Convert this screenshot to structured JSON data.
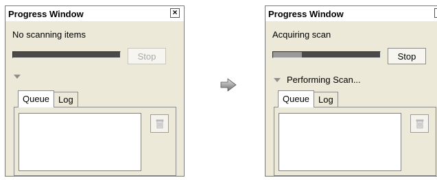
{
  "left_window": {
    "title": "Progress Window",
    "status": "No scanning items",
    "progress_fraction": 0,
    "stop_label": "Stop",
    "stop_enabled": false,
    "disclosure_label": "",
    "tabs": [
      "Queue",
      "Log"
    ],
    "active_tab": "Queue"
  },
  "right_window": {
    "title": "Progress Window",
    "status": "Acquiring scan",
    "progress_fraction": 0.27,
    "stop_label": "Stop",
    "stop_enabled": true,
    "disclosure_label": "Performing Scan...",
    "tabs": [
      "Queue",
      "Log"
    ],
    "active_tab": "Queue"
  },
  "icons": {
    "close": "close-icon",
    "trash": "trash-icon",
    "arrow": "arrow-right-icon",
    "disclosure": "disclosure-triangle-icon"
  },
  "colors": {
    "window_bg": "#ece9d8",
    "progress_empty": "#4a4a4a",
    "progress_fill": "#9a9a9a"
  }
}
